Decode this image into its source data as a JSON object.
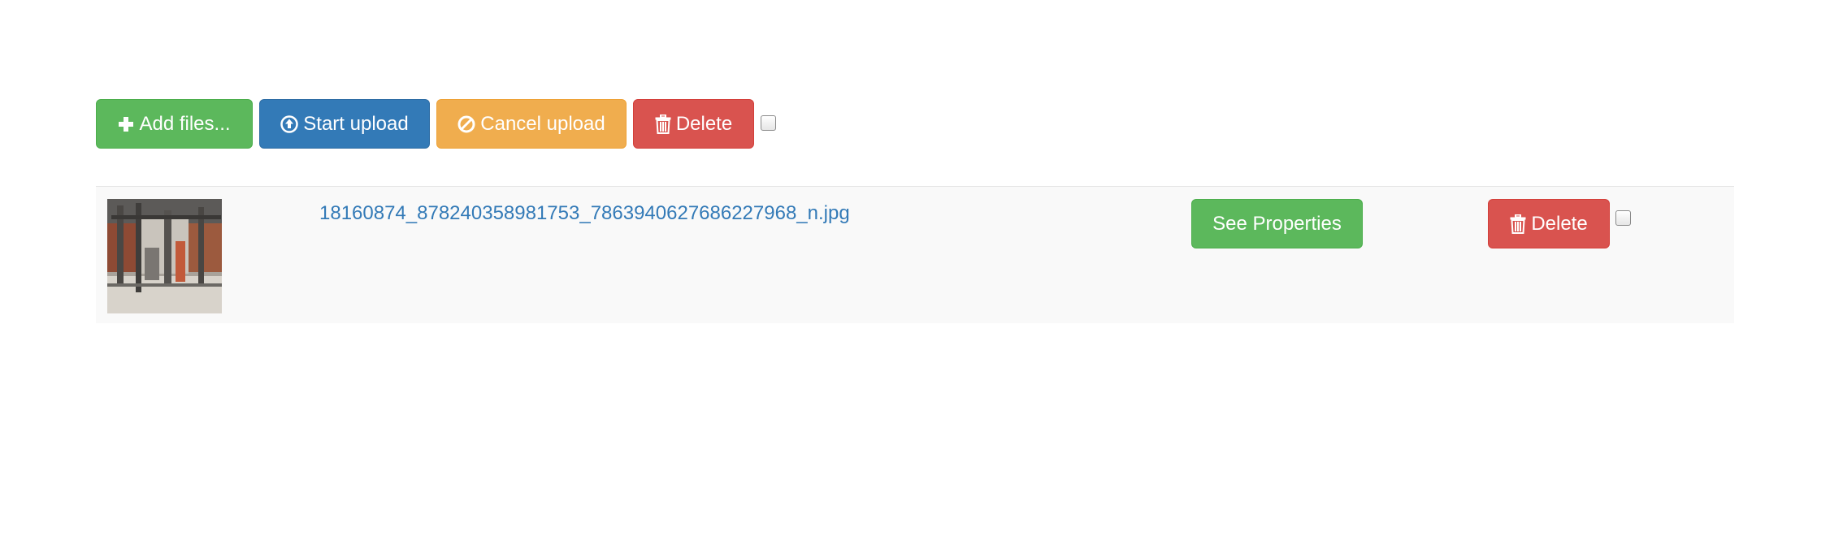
{
  "toolbar": {
    "add_files_label": "Add files...",
    "start_upload_label": "Start upload",
    "cancel_upload_label": "Cancel upload",
    "delete_label": "Delete",
    "select_all_checked": false
  },
  "files": [
    {
      "name": "18160874_878240358981753_7863940627686227968_n.jpg",
      "see_properties_label": "See Properties",
      "delete_label": "Delete",
      "checked": false
    }
  ],
  "colors": {
    "success": "#5cb85c",
    "primary": "#337ab7",
    "warning": "#f0ad4e",
    "danger": "#d9534f",
    "link": "#337ab7",
    "row_background": "#f9f9f9"
  },
  "icons": {
    "add": "plus-icon",
    "start": "circle-arrow-up-icon",
    "cancel": "ban-icon",
    "delete": "trash-icon"
  }
}
